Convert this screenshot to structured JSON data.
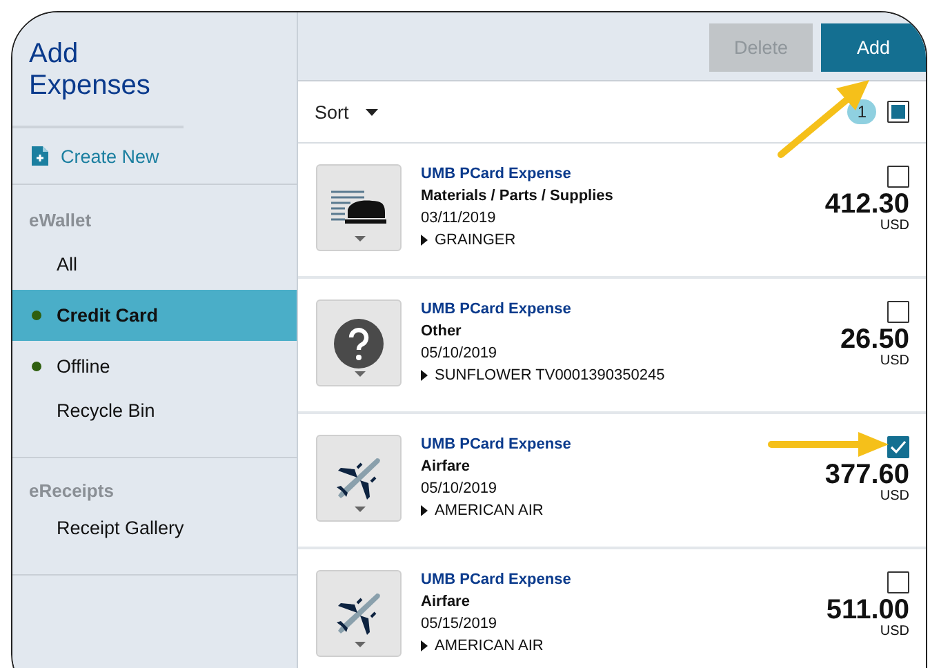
{
  "sidebar": {
    "title": "Add Expenses",
    "items": [
      {
        "kind": "action",
        "label": "Create New"
      },
      {
        "kind": "heading",
        "label": "eWallet"
      },
      {
        "kind": "item",
        "label": "All",
        "selected": false
      },
      {
        "kind": "item",
        "label": "Credit Card",
        "selected": true,
        "color": "#2f5f0f"
      },
      {
        "kind": "item",
        "label": "Offline",
        "selected": false,
        "color": "#2f5f0f"
      },
      {
        "kind": "item",
        "label": "Recycle Bin",
        "selected": false
      },
      {
        "kind": "heading",
        "label": "eReceipts"
      },
      {
        "kind": "item",
        "label": "Receipt Gallery",
        "selected": false
      }
    ]
  },
  "toolbar": {
    "buttons": [
      {
        "label": "Delete",
        "disabled": true
      },
      {
        "label": "Add",
        "disabled": false
      }
    ]
  },
  "list_header": {
    "sort": "Sort",
    "selected_count": "1",
    "select_all": {
      "indeterminate": true
    }
  },
  "expenses": [
    {
      "kind": "stapler",
      "card": "UMB PCard Expense",
      "category": "Materials / Parts / Supplies",
      "date": "03/11/2019",
      "merchant": "GRAINGER",
      "amount": "412.30",
      "currency": "USD",
      "checked": false
    },
    {
      "kind": "question",
      "card": "UMB PCard Expense",
      "category": "Other",
      "date": "05/10/2019",
      "merchant": "SUNFLOWER TV0001390350245",
      "amount": "26.50",
      "currency": "USD",
      "checked": false
    },
    {
      "kind": "airplane",
      "card": "UMB PCard Expense",
      "category": "Airfare",
      "date": "05/10/2019",
      "merchant": "AMERICAN AIR",
      "amount": "377.60",
      "currency": "USD",
      "checked": true
    },
    {
      "kind": "airplane",
      "card": "UMB PCard Expense",
      "category": "Airfare",
      "date": "05/15/2019",
      "merchant": "AMERICAN AIR",
      "amount": "511.00",
      "currency": "USD",
      "checked": false
    }
  ]
}
